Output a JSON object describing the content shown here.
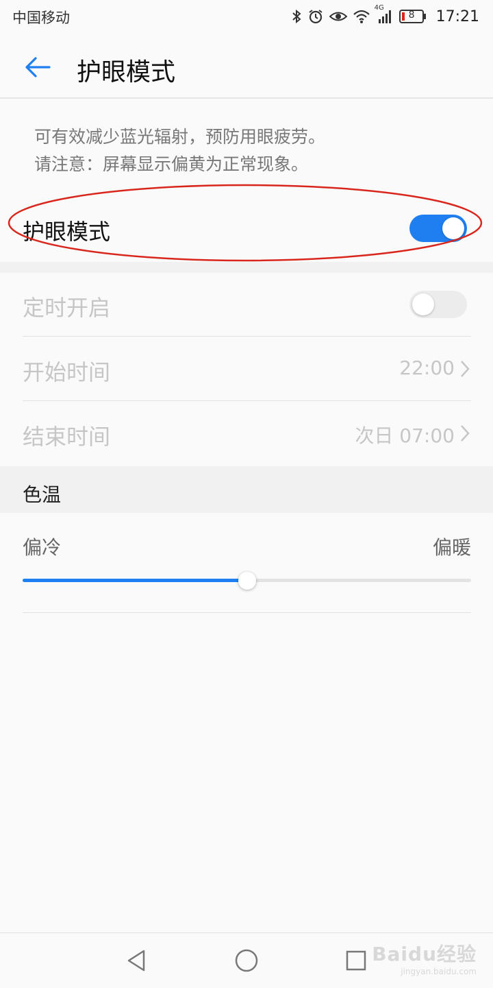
{
  "status_bar": {
    "carrier": "中国移动",
    "network_badge": "4G",
    "battery_level": "8",
    "time": "17:21"
  },
  "header": {
    "title": "护眼模式"
  },
  "description": {
    "line1": "可有效减少蓝光辐射，预防用眼疲劳。",
    "line2": "请注意：屏幕显示偏黄为正常现象。"
  },
  "eye_comfort": {
    "label": "护眼模式",
    "enabled": true
  },
  "schedule": {
    "label": "定时开启",
    "enabled": false,
    "start_label": "开始时间",
    "start_value": "22:00",
    "end_label": "结束时间",
    "end_value": "次日 07:00"
  },
  "color_temp": {
    "section_label": "色温",
    "min_label": "偏冷",
    "max_label": "偏暖",
    "value_fraction": 0.5
  },
  "watermark": {
    "brand": "Baidu经验",
    "url": "jingyan.baidu.com"
  },
  "colors": {
    "accent": "#1f7ff0",
    "annotation": "#d9261c"
  }
}
